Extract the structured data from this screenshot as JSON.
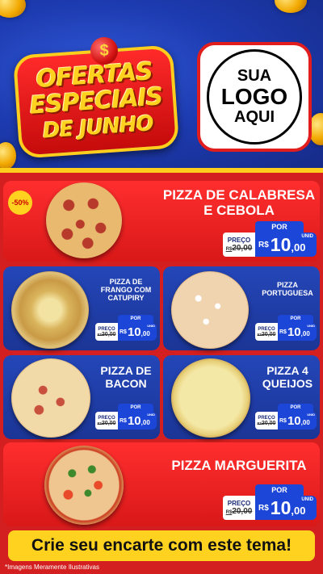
{
  "header": {
    "title_lines": [
      "OFERTAS",
      "ESPECIAIS",
      "DE JUNHO"
    ],
    "dollar_symbol": "$",
    "logo": {
      "line1": "SUA",
      "line2": "LOGO",
      "line3": "AQUI"
    }
  },
  "products": [
    {
      "name": "PIZZA DE CALABRESA E CEBOLA",
      "badge": "-50%",
      "por_label": "POR",
      "preco_label": "PREÇO",
      "old_currency": "R$",
      "old_price": "20,00",
      "currency": "R$",
      "price_int": "10",
      "price_dec": ",00",
      "unit": "UNID"
    },
    {
      "name": "PIZZA DE FRANGO COM CATUPIRY",
      "por_label": "POR",
      "preco_label": "PREÇO",
      "old_currency": "R$",
      "old_price": "20,00",
      "currency": "R$",
      "price_int": "10",
      "price_dec": ",00",
      "unit": "UNID"
    },
    {
      "name": "PIZZA PORTUGUESA",
      "por_label": "POR",
      "preco_label": "PREÇO",
      "old_currency": "R$",
      "old_price": "20,00",
      "currency": "R$",
      "price_int": "10",
      "price_dec": ",00",
      "unit": "UNID"
    },
    {
      "name": "PIZZA DE BACON",
      "por_label": "POR",
      "preco_label": "PREÇO",
      "old_currency": "R$",
      "old_price": "20,00",
      "currency": "R$",
      "price_int": "10",
      "price_dec": ",00",
      "unit": "UNID"
    },
    {
      "name": "PIZZA 4 QUEIJOS",
      "por_label": "POR",
      "preco_label": "PREÇO",
      "old_currency": "R$",
      "old_price": "20,00",
      "currency": "R$",
      "price_int": "10",
      "price_dec": ",00",
      "unit": "UNID"
    },
    {
      "name": "PIZZA MARGUERITA",
      "por_label": "POR",
      "preco_label": "PREÇO",
      "old_currency": "R$",
      "old_price": "20,00",
      "currency": "R$",
      "price_int": "10",
      "price_dec": ",00",
      "unit": "UNID"
    }
  ],
  "cta": "Crie seu encarte com este tema!",
  "disclaimer": "*Imagens Meramente Ilustrativas",
  "colors": {
    "red": "#d31f1f",
    "blue": "#1b3596",
    "yellow": "#ffd21f",
    "price_blue": "#1c46d8"
  }
}
